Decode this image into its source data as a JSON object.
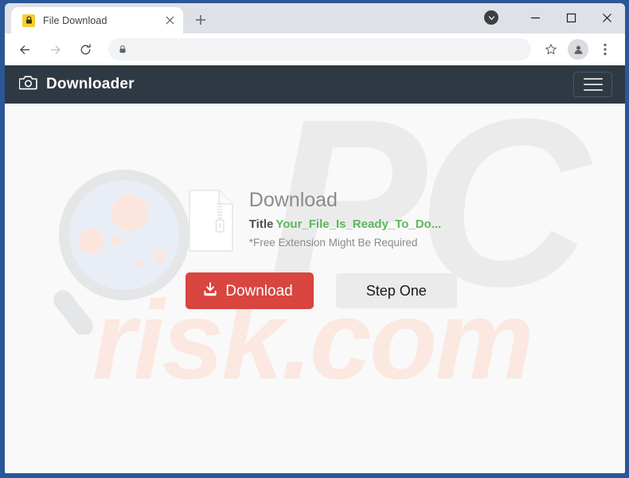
{
  "browser": {
    "tab": {
      "title": "File Download",
      "favicon": "padlock-icon",
      "close_label": "×"
    },
    "new_tab_label": "+",
    "window_controls": {
      "tab_search": "tab-search-icon",
      "minimize": "–",
      "maximize": "□",
      "close": "✕"
    },
    "toolbar": {
      "back": "back-icon",
      "forward": "forward-icon",
      "reload": "reload-icon",
      "omnibox_value": "",
      "omnibox_placeholder": "",
      "lock": "lock-icon",
      "bookmark": "star-icon",
      "profile": "avatar-icon",
      "menu": "kebab-menu-icon"
    },
    "frame_color": "#2b5797",
    "tabstrip_color": "#dee1e6"
  },
  "site": {
    "header": {
      "brand_icon": "camera-icon",
      "brand_name": "Downloader",
      "menu_button": "hamburger-menu-icon",
      "bar_color": "#2f3943"
    },
    "watermarks": {
      "primary": "PC",
      "secondary": "risk.com",
      "primary_color": "#ebebeb",
      "secondary_color": "#fbe8e0"
    },
    "illustration": {
      "name": "magnifying-glass-illustration",
      "ring_color": "#e4e6e8",
      "lens_color": "#e9eef6",
      "dot_color": "#fce5dc"
    },
    "content": {
      "file_icon": "zip-file-icon",
      "heading": "Download",
      "title_label": "Title",
      "title_value": "Your_File_Is_Ready_To_Do...",
      "note": "*Free Extension Might Be Required",
      "heading_color": "#8b8b8b",
      "title_value_color": "#5cb85c"
    },
    "buttons": {
      "download_label": "Download",
      "download_icon": "download-icon",
      "download_color": "#d9453f",
      "step_label": "Step One",
      "step_color": "#ebebeb"
    }
  }
}
